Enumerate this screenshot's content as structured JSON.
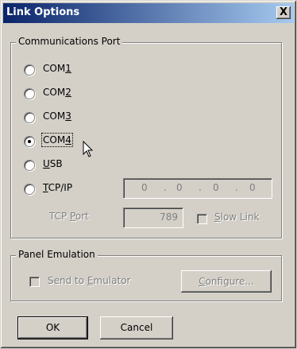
{
  "window": {
    "title": "Link Options",
    "close_label": "X"
  },
  "comm_port": {
    "legend": "Communications Port",
    "options": [
      {
        "pre": "COM",
        "key": "1",
        "post": "",
        "selected": false
      },
      {
        "pre": "COM",
        "key": "2",
        "post": "",
        "selected": false
      },
      {
        "pre": "COM",
        "key": "3",
        "post": "",
        "selected": false
      },
      {
        "pre": "COM",
        "key": "4",
        "post": "",
        "selected": true
      },
      {
        "pre": "",
        "key": "U",
        "post": "SB",
        "selected": false
      },
      {
        "pre": "",
        "key": "T",
        "post": "CP/IP",
        "selected": false
      }
    ],
    "ip_address": [
      "0",
      "0",
      "0",
      "0"
    ],
    "tcp_port_label_pre": "TCP ",
    "tcp_port_label_key": "P",
    "tcp_port_label_post": "ort",
    "tcp_port_value": "789",
    "slow_link_key": "S",
    "slow_link_post": "low Link"
  },
  "panel_emulation": {
    "legend": "Panel Emulation",
    "send_pre": "Send to ",
    "send_key": "E",
    "send_post": "mulator",
    "configure_key": "C",
    "configure_post": "onfigure..."
  },
  "buttons": {
    "ok": "OK",
    "cancel": "Cancel"
  }
}
